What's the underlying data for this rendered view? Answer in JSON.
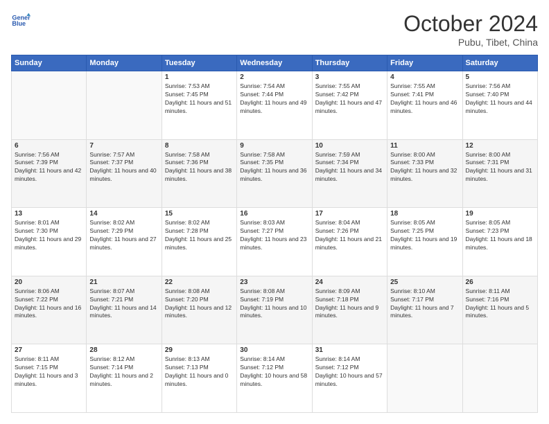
{
  "logo": {
    "line1": "General",
    "line2": "Blue"
  },
  "title": "October 2024",
  "subtitle": "Pubu, Tibet, China",
  "weekdays": [
    "Sunday",
    "Monday",
    "Tuesday",
    "Wednesday",
    "Thursday",
    "Friday",
    "Saturday"
  ],
  "weeks": [
    [
      {
        "day": "",
        "sunrise": "",
        "sunset": "",
        "daylight": ""
      },
      {
        "day": "",
        "sunrise": "",
        "sunset": "",
        "daylight": ""
      },
      {
        "day": "1",
        "sunrise": "Sunrise: 7:53 AM",
        "sunset": "Sunset: 7:45 PM",
        "daylight": "Daylight: 11 hours and 51 minutes."
      },
      {
        "day": "2",
        "sunrise": "Sunrise: 7:54 AM",
        "sunset": "Sunset: 7:44 PM",
        "daylight": "Daylight: 11 hours and 49 minutes."
      },
      {
        "day": "3",
        "sunrise": "Sunrise: 7:55 AM",
        "sunset": "Sunset: 7:42 PM",
        "daylight": "Daylight: 11 hours and 47 minutes."
      },
      {
        "day": "4",
        "sunrise": "Sunrise: 7:55 AM",
        "sunset": "Sunset: 7:41 PM",
        "daylight": "Daylight: 11 hours and 46 minutes."
      },
      {
        "day": "5",
        "sunrise": "Sunrise: 7:56 AM",
        "sunset": "Sunset: 7:40 PM",
        "daylight": "Daylight: 11 hours and 44 minutes."
      }
    ],
    [
      {
        "day": "6",
        "sunrise": "Sunrise: 7:56 AM",
        "sunset": "Sunset: 7:39 PM",
        "daylight": "Daylight: 11 hours and 42 minutes."
      },
      {
        "day": "7",
        "sunrise": "Sunrise: 7:57 AM",
        "sunset": "Sunset: 7:37 PM",
        "daylight": "Daylight: 11 hours and 40 minutes."
      },
      {
        "day": "8",
        "sunrise": "Sunrise: 7:58 AM",
        "sunset": "Sunset: 7:36 PM",
        "daylight": "Daylight: 11 hours and 38 minutes."
      },
      {
        "day": "9",
        "sunrise": "Sunrise: 7:58 AM",
        "sunset": "Sunset: 7:35 PM",
        "daylight": "Daylight: 11 hours and 36 minutes."
      },
      {
        "day": "10",
        "sunrise": "Sunrise: 7:59 AM",
        "sunset": "Sunset: 7:34 PM",
        "daylight": "Daylight: 11 hours and 34 minutes."
      },
      {
        "day": "11",
        "sunrise": "Sunrise: 8:00 AM",
        "sunset": "Sunset: 7:33 PM",
        "daylight": "Daylight: 11 hours and 32 minutes."
      },
      {
        "day": "12",
        "sunrise": "Sunrise: 8:00 AM",
        "sunset": "Sunset: 7:31 PM",
        "daylight": "Daylight: 11 hours and 31 minutes."
      }
    ],
    [
      {
        "day": "13",
        "sunrise": "Sunrise: 8:01 AM",
        "sunset": "Sunset: 7:30 PM",
        "daylight": "Daylight: 11 hours and 29 minutes."
      },
      {
        "day": "14",
        "sunrise": "Sunrise: 8:02 AM",
        "sunset": "Sunset: 7:29 PM",
        "daylight": "Daylight: 11 hours and 27 minutes."
      },
      {
        "day": "15",
        "sunrise": "Sunrise: 8:02 AM",
        "sunset": "Sunset: 7:28 PM",
        "daylight": "Daylight: 11 hours and 25 minutes."
      },
      {
        "day": "16",
        "sunrise": "Sunrise: 8:03 AM",
        "sunset": "Sunset: 7:27 PM",
        "daylight": "Daylight: 11 hours and 23 minutes."
      },
      {
        "day": "17",
        "sunrise": "Sunrise: 8:04 AM",
        "sunset": "Sunset: 7:26 PM",
        "daylight": "Daylight: 11 hours and 21 minutes."
      },
      {
        "day": "18",
        "sunrise": "Sunrise: 8:05 AM",
        "sunset": "Sunset: 7:25 PM",
        "daylight": "Daylight: 11 hours and 19 minutes."
      },
      {
        "day": "19",
        "sunrise": "Sunrise: 8:05 AM",
        "sunset": "Sunset: 7:23 PM",
        "daylight": "Daylight: 11 hours and 18 minutes."
      }
    ],
    [
      {
        "day": "20",
        "sunrise": "Sunrise: 8:06 AM",
        "sunset": "Sunset: 7:22 PM",
        "daylight": "Daylight: 11 hours and 16 minutes."
      },
      {
        "day": "21",
        "sunrise": "Sunrise: 8:07 AM",
        "sunset": "Sunset: 7:21 PM",
        "daylight": "Daylight: 11 hours and 14 minutes."
      },
      {
        "day": "22",
        "sunrise": "Sunrise: 8:08 AM",
        "sunset": "Sunset: 7:20 PM",
        "daylight": "Daylight: 11 hours and 12 minutes."
      },
      {
        "day": "23",
        "sunrise": "Sunrise: 8:08 AM",
        "sunset": "Sunset: 7:19 PM",
        "daylight": "Daylight: 11 hours and 10 minutes."
      },
      {
        "day": "24",
        "sunrise": "Sunrise: 8:09 AM",
        "sunset": "Sunset: 7:18 PM",
        "daylight": "Daylight: 11 hours and 9 minutes."
      },
      {
        "day": "25",
        "sunrise": "Sunrise: 8:10 AM",
        "sunset": "Sunset: 7:17 PM",
        "daylight": "Daylight: 11 hours and 7 minutes."
      },
      {
        "day": "26",
        "sunrise": "Sunrise: 8:11 AM",
        "sunset": "Sunset: 7:16 PM",
        "daylight": "Daylight: 11 hours and 5 minutes."
      }
    ],
    [
      {
        "day": "27",
        "sunrise": "Sunrise: 8:11 AM",
        "sunset": "Sunset: 7:15 PM",
        "daylight": "Daylight: 11 hours and 3 minutes."
      },
      {
        "day": "28",
        "sunrise": "Sunrise: 8:12 AM",
        "sunset": "Sunset: 7:14 PM",
        "daylight": "Daylight: 11 hours and 2 minutes."
      },
      {
        "day": "29",
        "sunrise": "Sunrise: 8:13 AM",
        "sunset": "Sunset: 7:13 PM",
        "daylight": "Daylight: 11 hours and 0 minutes."
      },
      {
        "day": "30",
        "sunrise": "Sunrise: 8:14 AM",
        "sunset": "Sunset: 7:12 PM",
        "daylight": "Daylight: 10 hours and 58 minutes."
      },
      {
        "day": "31",
        "sunrise": "Sunrise: 8:14 AM",
        "sunset": "Sunset: 7:12 PM",
        "daylight": "Daylight: 10 hours and 57 minutes."
      },
      {
        "day": "",
        "sunrise": "",
        "sunset": "",
        "daylight": ""
      },
      {
        "day": "",
        "sunrise": "",
        "sunset": "",
        "daylight": ""
      }
    ]
  ]
}
